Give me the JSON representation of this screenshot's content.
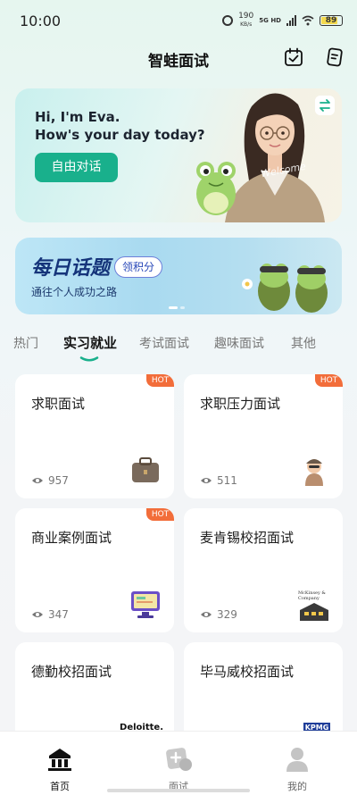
{
  "status_bar": {
    "time": "10:00",
    "speed_value": "190",
    "speed_unit": "KB/s",
    "network": "5G HD",
    "battery": "89"
  },
  "header": {
    "title": "智蛙面试",
    "icons": [
      "calendar-check-icon",
      "notes-icon"
    ]
  },
  "hero": {
    "greeting_line1": "Hi, I'm Eva.",
    "greeting_line2": "How's your day today?",
    "button_label": "自由对话",
    "mascot_text": "Welcome"
  },
  "banner": {
    "title": "每日话题",
    "badge": "领积分",
    "subtitle": "通往个人成功之路"
  },
  "tabs": [
    {
      "label": "热门",
      "active": false
    },
    {
      "label": "实习就业",
      "active": true
    },
    {
      "label": "考试面试",
      "active": false
    },
    {
      "label": "趣味面试",
      "active": false
    },
    {
      "label": "其他",
      "active": false
    }
  ],
  "cards": [
    {
      "title": "求职面试",
      "hot": "HOT",
      "views": "957",
      "image": "briefcase-icon"
    },
    {
      "title": "求职压力面试",
      "hot": "HOT",
      "views": "511",
      "image": "person-icon"
    },
    {
      "title": "商业案例面试",
      "hot": "HOT",
      "views": "347",
      "image": "monitor-icon"
    },
    {
      "title": "麦肯锡校招面试",
      "hot": "",
      "views": "329",
      "image": "building-icon",
      "logo_text": "McKinsey & Company"
    },
    {
      "title": "德勤校招面试",
      "hot": "",
      "views": "",
      "image": "logo-icon",
      "logo_text": "Deloitte."
    },
    {
      "title": "毕马威校招面试",
      "hot": "",
      "views": "",
      "image": "logo-icon",
      "logo_text": "KPMG"
    }
  ],
  "bottom_nav": [
    {
      "label": "首页",
      "icon": "home-icon",
      "active": true
    },
    {
      "label": "面试",
      "icon": "interview-icon",
      "active": false
    },
    {
      "label": "我的",
      "icon": "profile-icon",
      "active": false
    }
  ],
  "colors": {
    "accent": "#19b08c",
    "hot": "#f26d3a",
    "banner_title": "#15347a"
  }
}
